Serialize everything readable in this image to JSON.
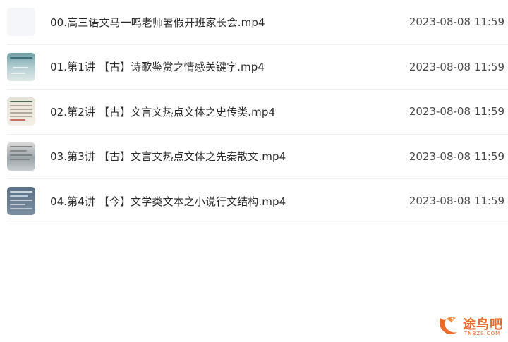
{
  "files": [
    {
      "name": "00.高三语文马一鸣老师暑假开班家长会.mp4",
      "date": "2023-08-08 11:59"
    },
    {
      "name": "01.第1讲 【古】诗歌鉴赏之情感关键字.mp4",
      "date": "2023-08-08 11:59"
    },
    {
      "name": "02.第2讲 【古】文言文热点文体之史传类.mp4",
      "date": "2023-08-08 11:59"
    },
    {
      "name": "03.第3讲 【古】文言文热点文体之先秦散文.mp4",
      "date": "2023-08-08 11:59"
    },
    {
      "name": "04.第4讲 【今】文学类文本之小说行文结构.mp4",
      "date": "2023-08-08 11:59"
    }
  ],
  "watermark": {
    "text": "途鸟吧",
    "subtext": "TNBZS.COM",
    "color": "#ea6a2c"
  }
}
